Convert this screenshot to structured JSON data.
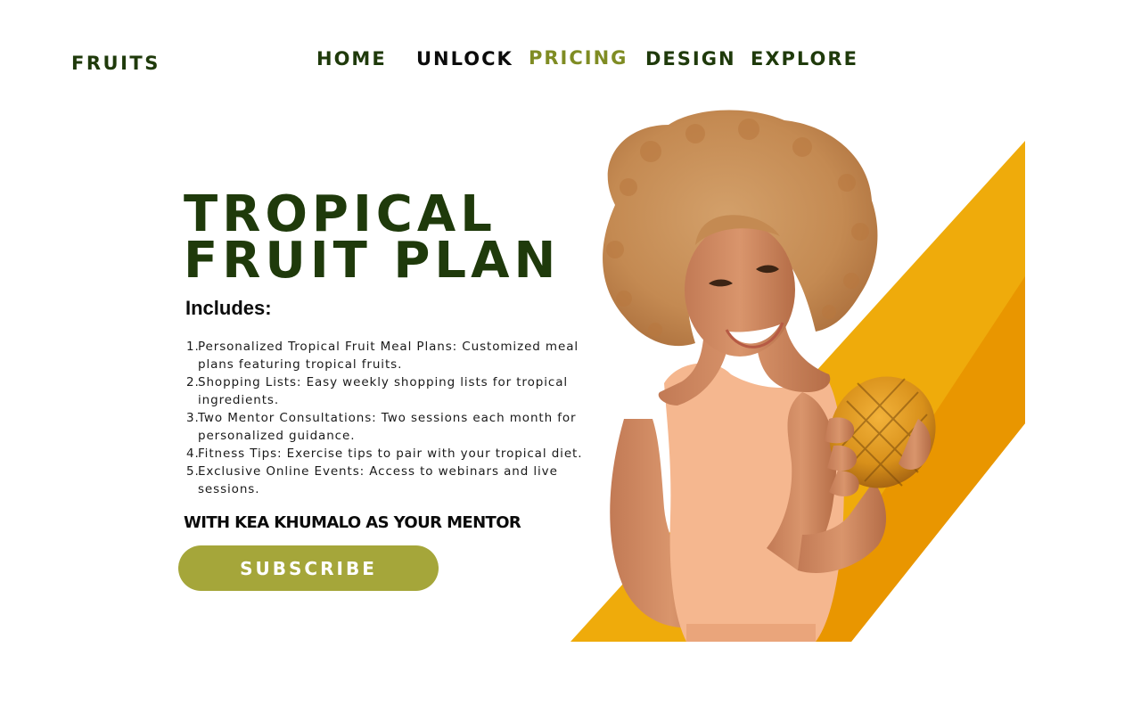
{
  "brand": {
    "logo": "FRUITS"
  },
  "nav": {
    "items": [
      {
        "label": "HOME"
      },
      {
        "label": "UNLOCK"
      },
      {
        "label": "PRICING"
      },
      {
        "label": "DESIGN"
      },
      {
        "label": "EXPLORE"
      }
    ],
    "active": "PRICING"
  },
  "hero": {
    "title_line1": "TROPICAL",
    "title_line2": "FRUIT PLAN",
    "includes_label": "Includes:",
    "features": [
      "Personalized Tropical Fruit Meal Plans: Customized meal plans featuring tropical fruits.",
      "Shopping Lists: Easy weekly shopping lists for tropical ingredients.",
      "Two Mentor Consultations: Two sessions each month for personalized guidance.",
      "Fitness Tips: Exercise tips to pair with your tropical diet.",
      "Exclusive Online Events: Access to webinars and live sessions."
    ],
    "mentor_line": "WITH KEA KHUMALO AS YOUR MENTOR",
    "cta_label": "SUBSCRIBE"
  },
  "image": {
    "subject": "smiling-woman-holding-pineapple",
    "icon": "photo"
  },
  "colors": {
    "dark_green": "#1f3a0b",
    "active_olive": "#7f8c23",
    "button_olive": "#a5a63a",
    "accent_yellow": "#efab0b",
    "accent_orange": "#e99600",
    "top_orange": "#f6b994"
  }
}
